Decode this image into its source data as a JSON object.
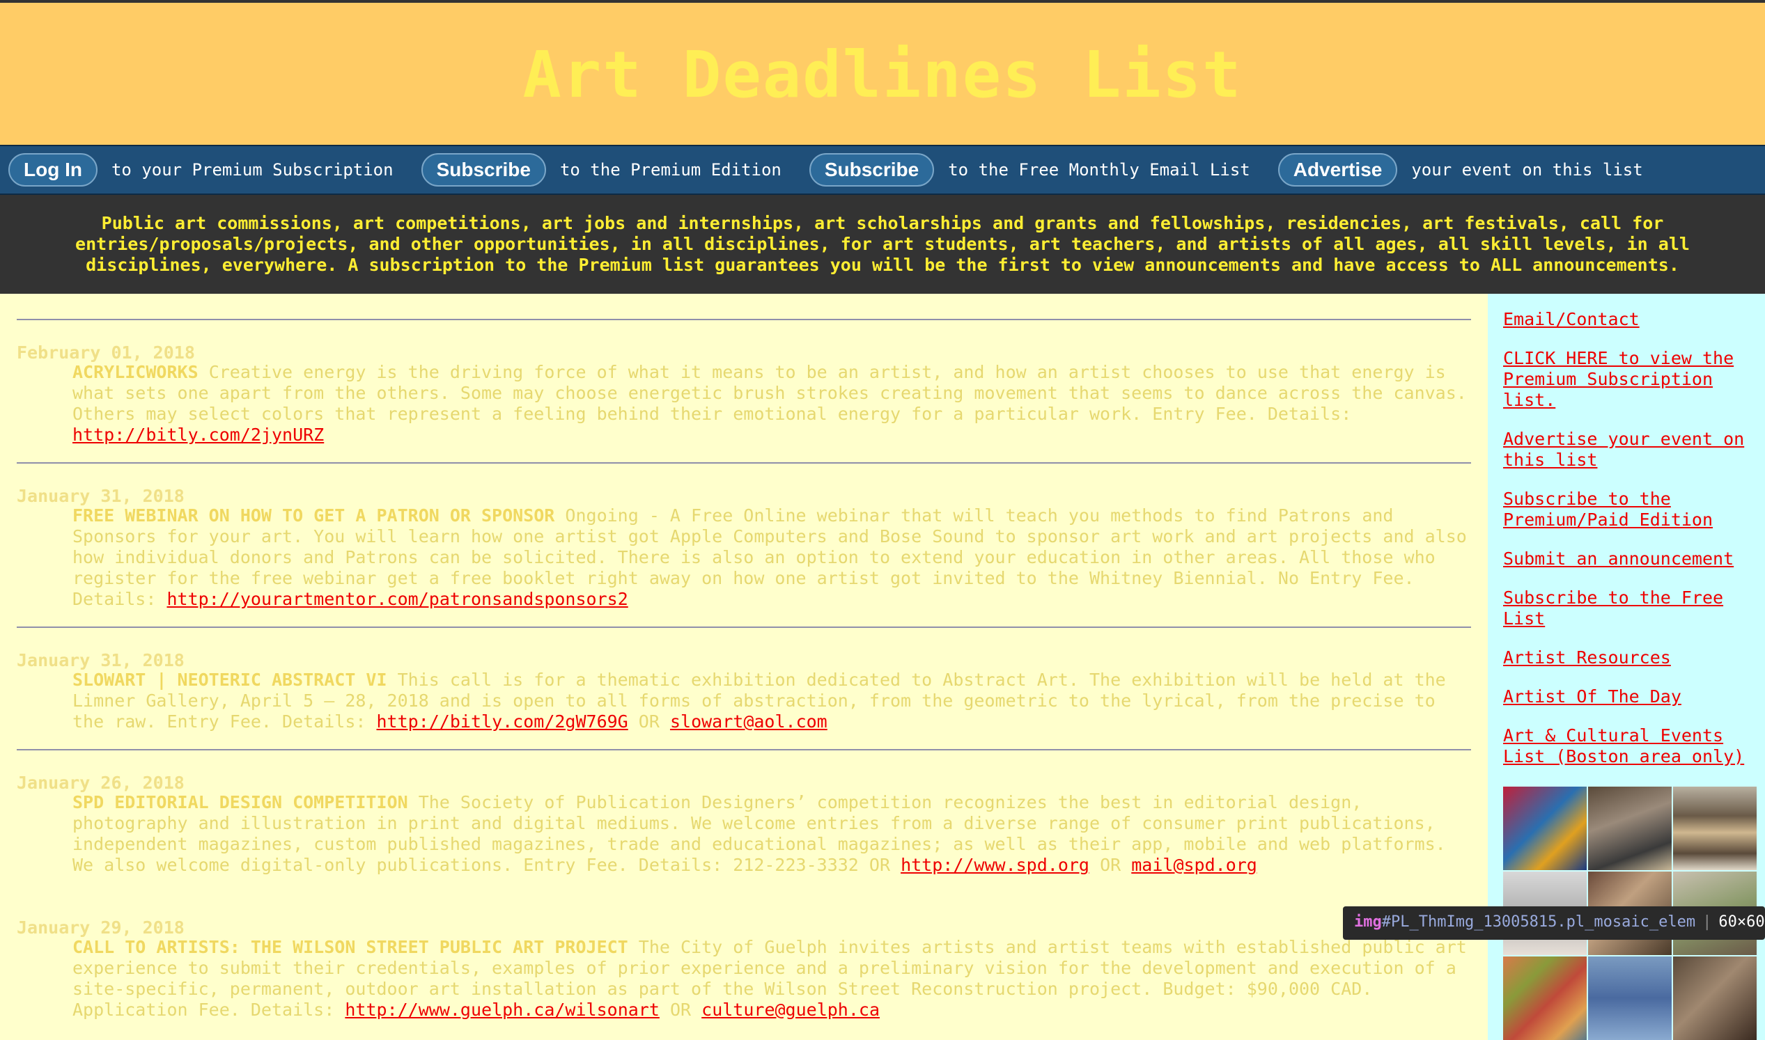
{
  "site": {
    "title": "Art Deadlines List"
  },
  "nav": [
    {
      "button": "Log In",
      "text": "to your Premium Subscription"
    },
    {
      "button": "Subscribe",
      "text": "to the Premium Edition"
    },
    {
      "button": "Subscribe",
      "text": "to the Free Monthly Email List"
    },
    {
      "button": "Advertise",
      "text": "your event on this list"
    }
  ],
  "banner": "Public art commissions, art competitions, art jobs and internships, art scholarships and grants and fellowships, residencies, art festivals, call for entries/proposals/projects, and other opportunities, in all disciplines, for art students, art teachers, and artists of all ages, all skill levels, in all disciplines, everywhere. A subscription to the Premium list guarantees you will be the first to view announcements and have access to ALL announcements.",
  "entries": [
    {
      "date": "February 01, 2018",
      "title": "ACRYLICWORKS",
      "body": "Creative energy is the driving force of what it means to be an artist, and how an artist chooses to use that energy is what sets one apart from the others. Some may choose energetic brush strokes creating movement that seems to dance across the canvas. Others may select colors that represent a feeling behind their emotional energy for a particular work. Entry Fee. Details:",
      "link1": "http://bitly.com/2jynURZ",
      "or": "",
      "link2": ""
    },
    {
      "date": "January 31, 2018",
      "title": "FREE WEBINAR ON HOW TO GET A PATRON OR SPONSOR",
      "body": "Ongoing - A Free Online webinar that will teach you methods to find Patrons and Sponsors for your art. You will learn how one artist got Apple Computers and Bose Sound to sponsor art work and art projects and also how individual donors and Patrons can be solicited. There is also an option to extend your education in other areas. All those who register for the free webinar get a free booklet right away on how one artist got invited to the Whitney Biennial. No Entry Fee. Details:",
      "link1": "http://yourartmentor.com/patronsandsponsors2",
      "or": "",
      "link2": ""
    },
    {
      "date": "January 31, 2018",
      "title": "SLOWART | NEOTERIC ABSTRACT VI",
      "body": "This call is for a thematic exhibition dedicated to Abstract Art. The exhibition will be held at the Limner Gallery, April 5 – 28, 2018 and is open to all forms of abstraction, from the geometric to the lyrical, from the precise to the raw. Entry Fee. Details:",
      "link1": "http://bitly.com/2gW769G",
      "or": "OR",
      "link2": "slowart@aol.com"
    },
    {
      "date": "January 26, 2018",
      "title": "SPD EDITORIAL DESIGN COMPETITION",
      "body": "The Society of Publication Designers’ competition recognizes the best in editorial design, photography and illustration in print and digital mediums. We welcome entries from a diverse range of consumer print publications, independent magazines, custom published magazines, trade and educational magazines; as well as their app, mobile and web platforms. We also welcome digital-only publications. Entry Fee. Details: 212-223-3332 OR",
      "link1": "http://www.spd.org",
      "or": "OR",
      "link2": "mail@spd.org"
    },
    {
      "date": "January 29, 2018",
      "title": "CALL TO ARTISTS: THE WILSON STREET PUBLIC ART PROJECT",
      "body": "The City of Guelph invites artists and artist teams with established public art experience to submit their credentials, examples of prior experience and a preliminary vision for the development and execution of a site-specific, permanent, outdoor art installation as part of the Wilson Street Reconstruction project. Budget: $90,000 CAD. Application Fee. Details:",
      "link1": "http://www.guelph.ca/wilsonart",
      "or": "OR",
      "link2": "culture@guelph.ca"
    }
  ],
  "sidebar": [
    "Email/Contact",
    "CLICK HERE to view the Premium Subscription list.",
    "Advertise your event on this list",
    "Subscribe to the Premium/Paid Edition",
    "Submit an announcement",
    "Subscribe to the Free List",
    "Artist Resources",
    "Artist Of The Day",
    "Art & Cultural Events List (Boston area only)"
  ],
  "tooltip": {
    "tag": "img",
    "selector": "#PL_ThmImg_13005815.pl_mosaic_elem",
    "size": "60×60"
  }
}
